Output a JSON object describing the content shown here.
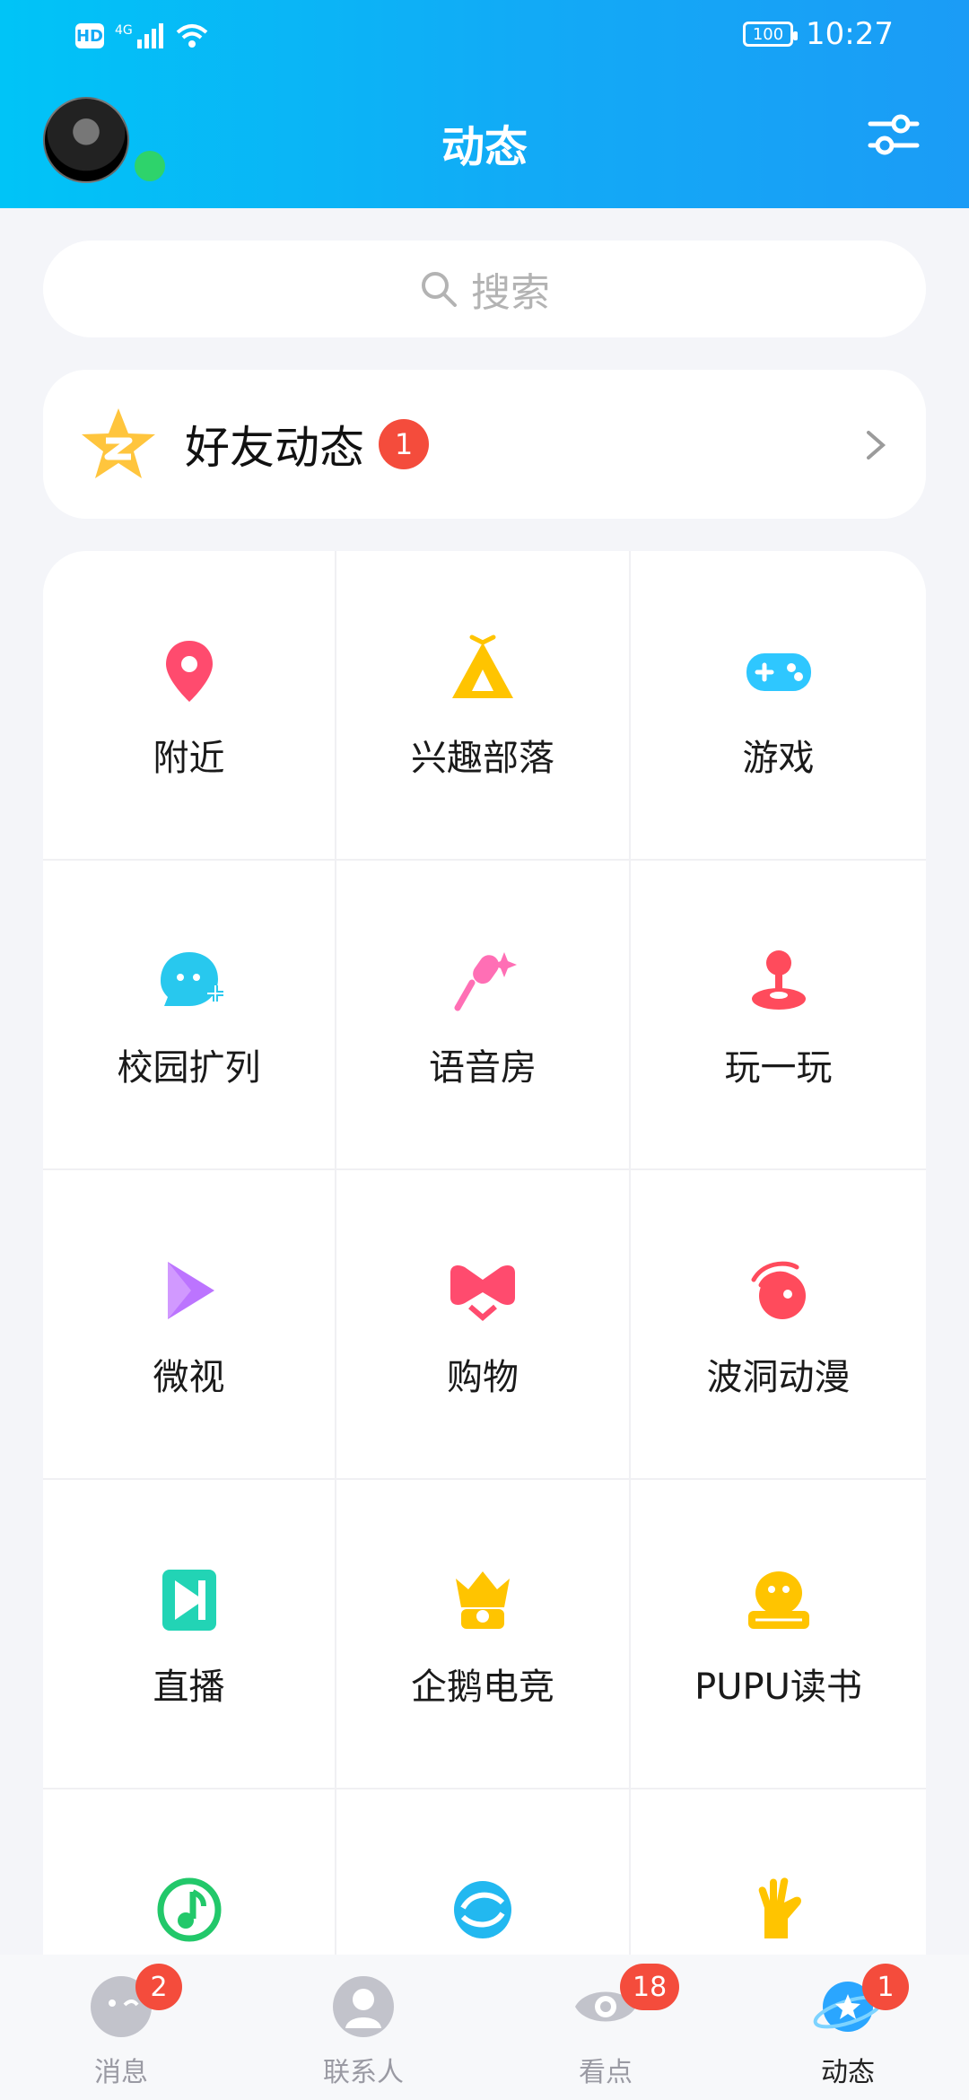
{
  "status_bar": {
    "hd": "HD",
    "network": "4G",
    "battery": "100",
    "time": "10:27"
  },
  "header": {
    "title": "动态"
  },
  "search": {
    "placeholder": "搜索"
  },
  "friend_feed": {
    "label": "好友动态",
    "badge": "1"
  },
  "grid": [
    {
      "label": "附近",
      "icon": "location-pin-icon",
      "color": "#ff4b6e"
    },
    {
      "label": "兴趣部落",
      "icon": "tent-icon",
      "color": "#ffc400"
    },
    {
      "label": "游戏",
      "icon": "gamepad-icon",
      "color": "#2ec7ff"
    },
    {
      "label": "校园扩列",
      "icon": "smiley-plus-icon",
      "color": "#28c8ee"
    },
    {
      "label": "语音房",
      "icon": "microphone-icon",
      "color": "#ff6fb5"
    },
    {
      "label": "玩一玩",
      "icon": "joystick-icon",
      "color": "#ff4b5c"
    },
    {
      "label": "微视",
      "icon": "play-icon",
      "color": "#b05cff"
    },
    {
      "label": "购物",
      "icon": "bow-icon",
      "color": "#ff4b6e"
    },
    {
      "label": "波洞动漫",
      "icon": "planet-icon",
      "color": "#ff4b5c"
    },
    {
      "label": "直播",
      "icon": "live-n-icon",
      "color": "#22d4b5"
    },
    {
      "label": "企鹅电竞",
      "icon": "crown-icon",
      "color": "#ffc400"
    },
    {
      "label": "PUPU读书",
      "icon": "penguin-book-icon",
      "color": "#ffc400"
    },
    {
      "label": "",
      "icon": "music-note-icon",
      "color": "#22c86a"
    },
    {
      "label": "",
      "icon": "swirl-icon",
      "color": "#22b8f0"
    },
    {
      "label": "",
      "icon": "hand-icon",
      "color": "#ffc400"
    }
  ],
  "tabs": [
    {
      "label": "消息",
      "badge": "2",
      "icon": "message-icon"
    },
    {
      "label": "联系人",
      "badge": "",
      "icon": "contacts-icon"
    },
    {
      "label": "看点",
      "badge": "18",
      "icon": "eye-icon"
    },
    {
      "label": "动态",
      "badge": "1",
      "icon": "planet-star-icon"
    }
  ]
}
